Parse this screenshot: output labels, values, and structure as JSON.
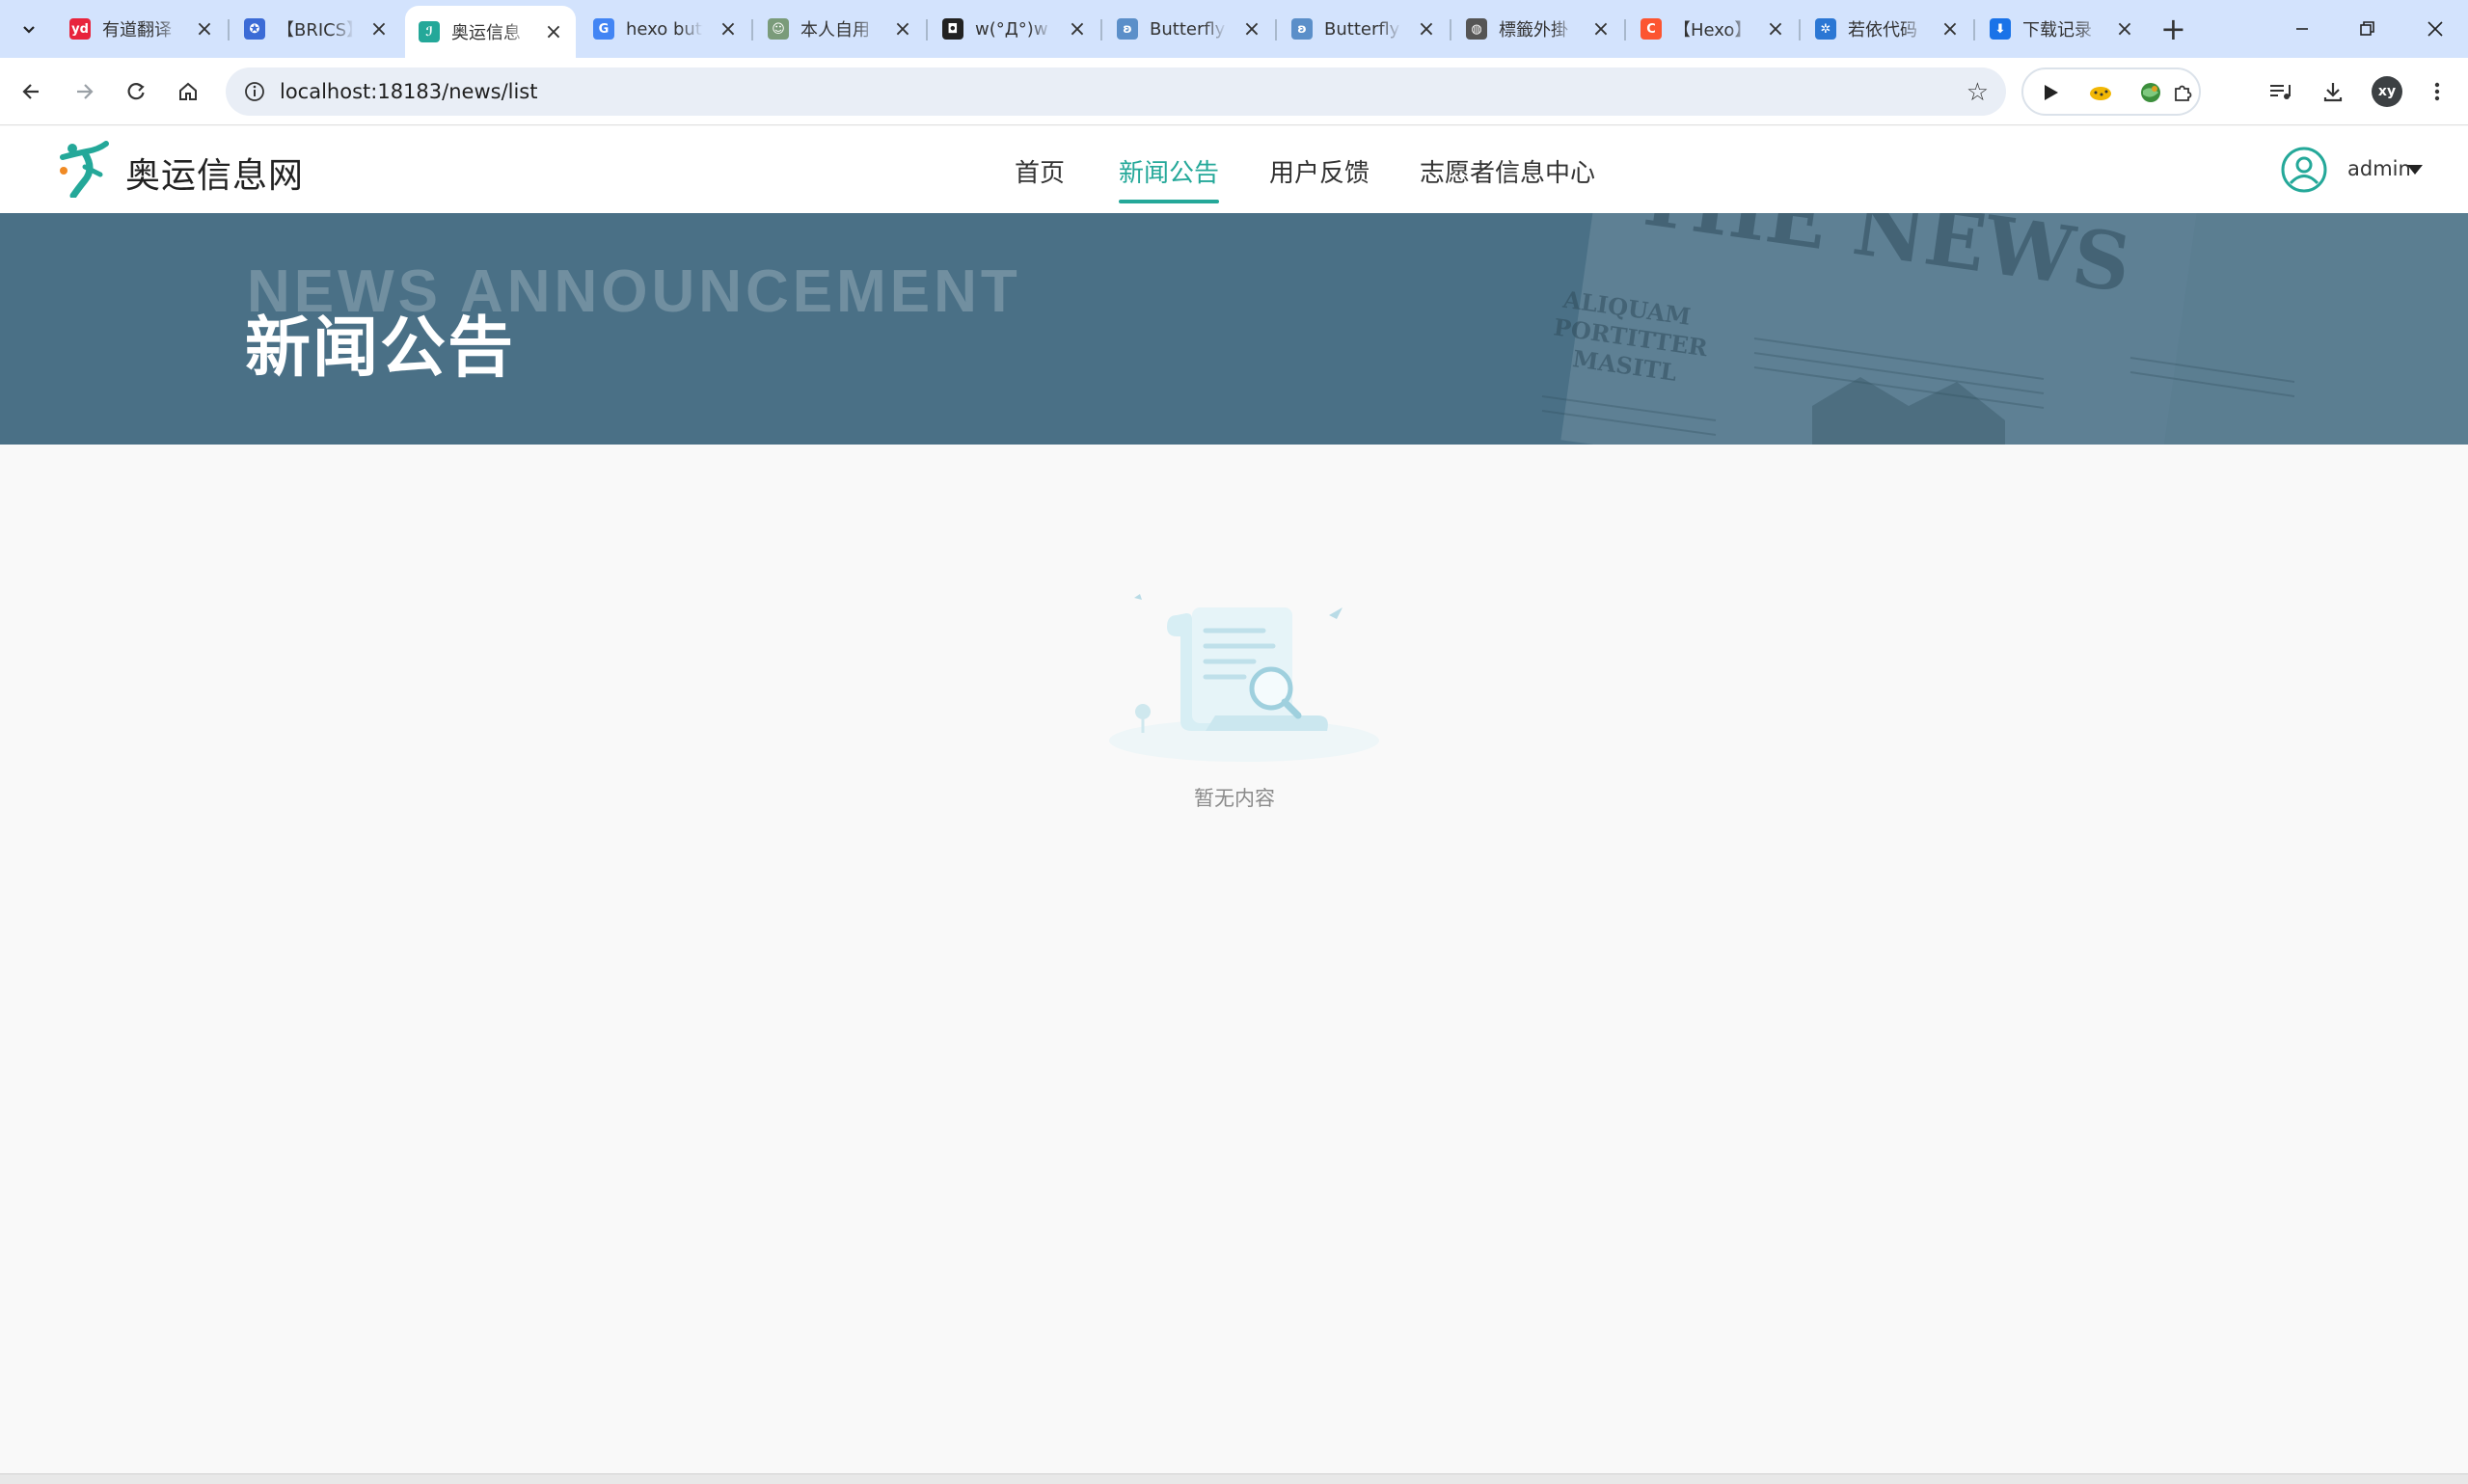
{
  "browser": {
    "tabs": [
      {
        "title": "有道翻译",
        "icon": "youdao-icon",
        "color": "#e8243c",
        "glyph": "yd"
      },
      {
        "title": "【BRICS】",
        "icon": "swirl-icon",
        "color": "#3b6bd6",
        "glyph": "✪"
      },
      {
        "title": "奥运信息",
        "icon": "olympic-logo-icon",
        "color": "#24a899",
        "glyph": "ℐ",
        "active": true
      },
      {
        "title": "hexo butterfly",
        "icon": "google-icon",
        "color": "#4285f4",
        "glyph": "G"
      },
      {
        "title": "本人自用",
        "icon": "avatar-icon",
        "color": "#7a9b7a",
        "glyph": "☺"
      },
      {
        "title": "w(°Д°)w",
        "icon": "dark-site-icon",
        "color": "#222222",
        "glyph": "◘"
      },
      {
        "title": "Butterfly",
        "icon": "butterfly-icon",
        "color": "#5b8fc9",
        "glyph": "ʚ"
      },
      {
        "title": "Butterfly",
        "icon": "butterfly-icon",
        "color": "#5b8fc9",
        "glyph": "ʚ"
      },
      {
        "title": "標籤外掛",
        "icon": "globe-icon",
        "color": "#555555",
        "glyph": "◍"
      },
      {
        "title": "【Hexo】",
        "icon": "csdn-icon",
        "color": "#fc5531",
        "glyph": "C"
      },
      {
        "title": "若依代码",
        "icon": "ruoyi-icon",
        "color": "#2b77d4",
        "glyph": "✲"
      },
      {
        "title": "下载记录",
        "icon": "download-icon",
        "color": "#1a73e8",
        "glyph": "⬇"
      }
    ],
    "url": "localhost:18183/news/list",
    "profile_initials": "xy"
  },
  "site": {
    "name": "奥运信息网",
    "nav": [
      "首页",
      "新闻公告",
      "用户反馈",
      "志愿者信息中心"
    ],
    "active_nav": "新闻公告",
    "user": "admin",
    "accent": "#24a899"
  },
  "banner": {
    "title_en": "NEWS ANNOUNCEMENT",
    "title_cn": "新闻公告",
    "bg_color": "#4a7086",
    "newspaper_headline": "THE NEWS",
    "newspaper_sub": "ALIQUAM PORTITTER MASITL"
  },
  "empty": {
    "text": "暂无内容"
  }
}
